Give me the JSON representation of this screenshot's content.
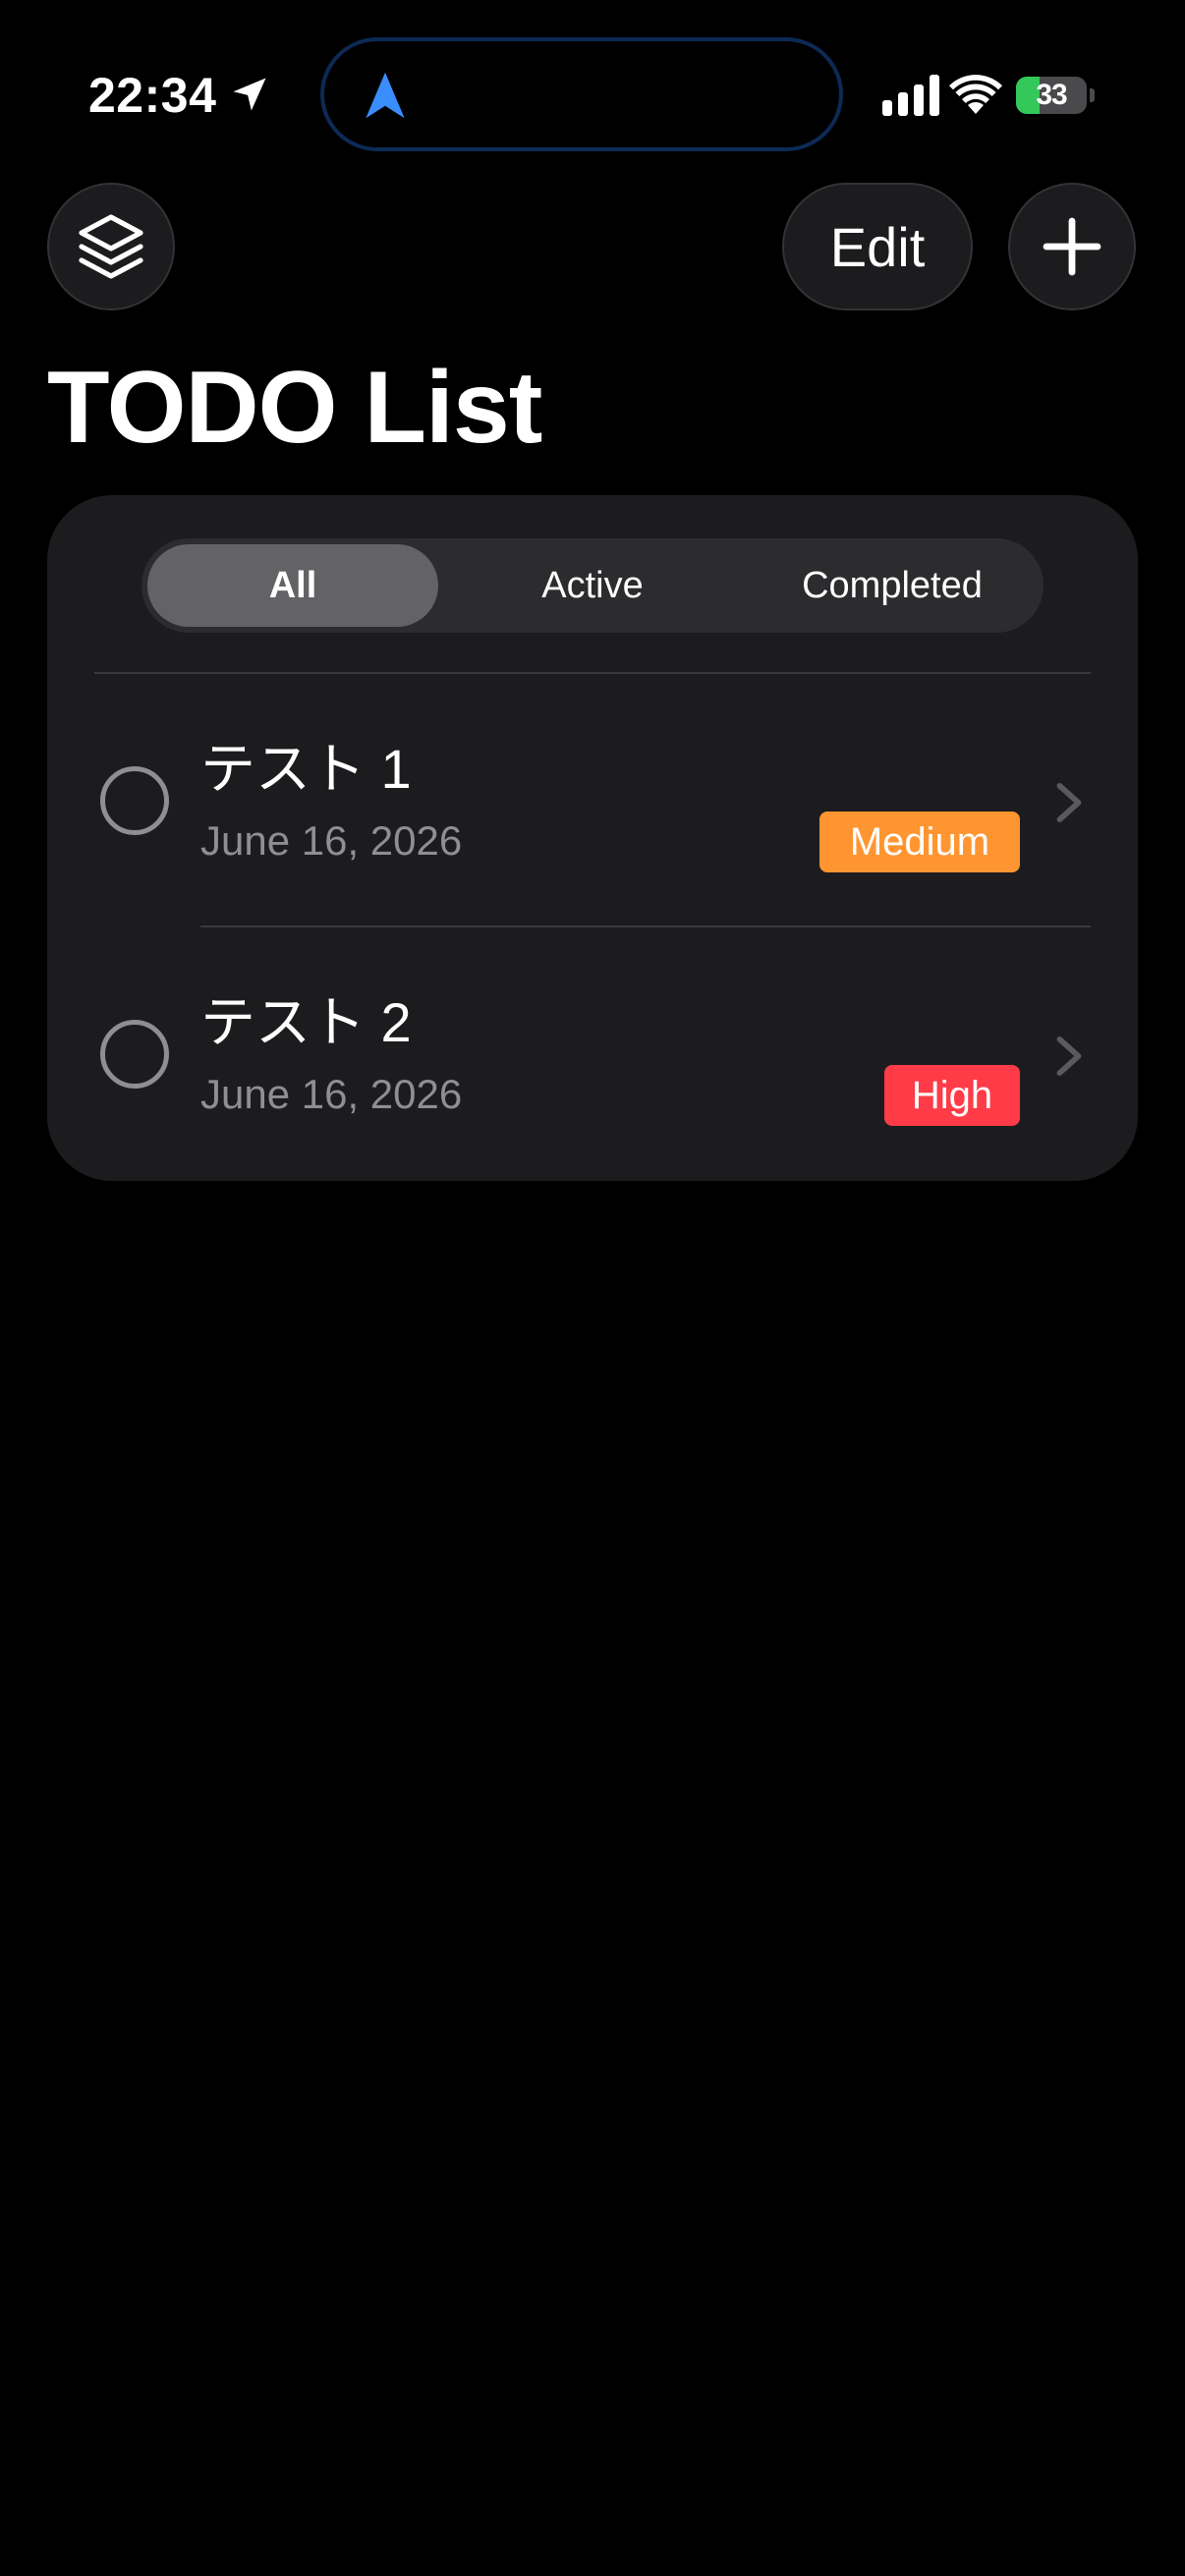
{
  "status_bar": {
    "time": "22:34",
    "battery_level": "33",
    "battery_fraction": 0.33
  },
  "toolbar": {
    "layers_icon": "layers-icon",
    "edit_label": "Edit",
    "add_icon": "plus-icon"
  },
  "page": {
    "title": "TODO List"
  },
  "filter": {
    "options": [
      "All",
      "Active",
      "Completed"
    ],
    "selected": "All"
  },
  "todos": [
    {
      "title": "テスト 1",
      "date": "June 16, 2026",
      "priority": "Medium",
      "priority_color": "#ff9530",
      "completed": false
    },
    {
      "title": "テスト 2",
      "date": "June 16, 2026",
      "priority": "High",
      "priority_color": "#ff3b47",
      "completed": false
    }
  ],
  "colors": {
    "background": "#000000",
    "card": "#1c1c1e",
    "accent_blue": "#3a8dff",
    "battery_green": "#34c759"
  }
}
